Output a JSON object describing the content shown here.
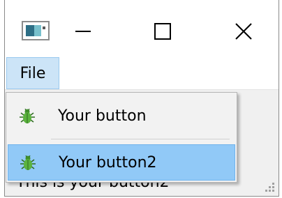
{
  "window": {
    "controls": {
      "minimize_icon": "minimize-icon",
      "maximize_icon": "maximize-icon",
      "close_icon": "close-icon"
    }
  },
  "menubar": {
    "file_label": "File"
  },
  "dropdown": {
    "items": [
      {
        "label": "Your button",
        "icon": "bug-icon"
      },
      {
        "label": "Your button2",
        "icon": "bug-icon",
        "highlighted": true
      }
    ]
  },
  "content": {
    "status_text": "This is your button2"
  },
  "colors": {
    "menu_highlight": "#91c9f7",
    "file_menu_bg": "#cce4f7",
    "window_bg": "#f0f0f0"
  }
}
